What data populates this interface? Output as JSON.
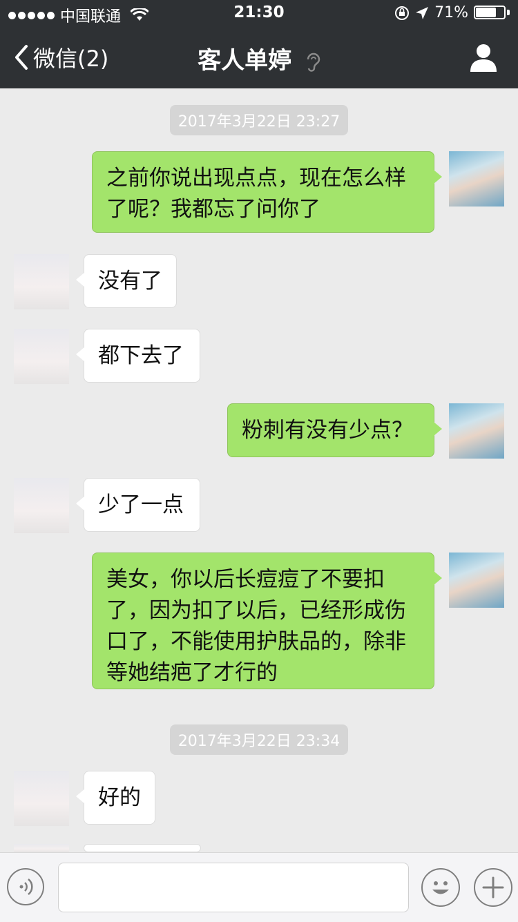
{
  "status_bar": {
    "carrier": "中国联通",
    "time": "21:30",
    "battery": "71%"
  },
  "nav": {
    "back_label": "微信(2)",
    "title": "客人单婷"
  },
  "timestamps": [
    "2017年3月22日 23:27",
    "2017年3月22日 23:34"
  ],
  "messages": [
    {
      "sender": "me",
      "text": "之前你说出现点点，现在怎么样了呢？我都忘了问你了"
    },
    {
      "sender": "client",
      "text": "没有了"
    },
    {
      "sender": "client",
      "text": "都下去了"
    },
    {
      "sender": "me",
      "text": "粉刺有没有少点？"
    },
    {
      "sender": "client",
      "text": "少了一点"
    },
    {
      "sender": "me",
      "text": "美女，你以后长痘痘了不要扣了，因为扣了以后，已经形成伤口了，不能使用护肤品的，除非等她结疤了才行的"
    },
    {
      "sender": "client",
      "text": "好的"
    }
  ]
}
